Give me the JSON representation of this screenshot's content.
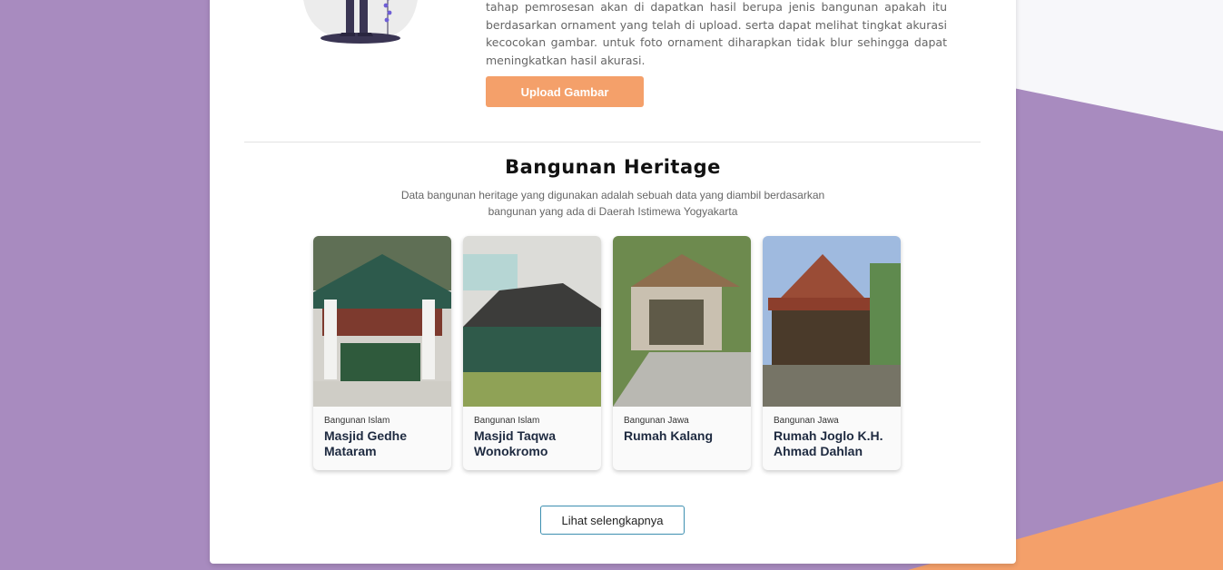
{
  "intro": {
    "text": "tahap pemrosesan akan di dapatkan hasil berupa jenis bangunan apakah itu berdasarkan ornament yang telah di upload. serta dapat melihat tingkat akurasi kecocokan gambar. untuk foto ornament diharapkan tidak blur sehingga dapat meningkatkan hasil akurasi.",
    "upload_label": "Upload Gambar"
  },
  "section": {
    "title": "Bangunan Heritage",
    "description_line1": "Data bangunan heritage yang digunakan adalah sebuah data yang diambil berdasarkan",
    "description_line2": "bangunan yang ada di Daerah Istimewa Yogyakarta"
  },
  "cards": [
    {
      "category": "Bangunan Islam",
      "name": "Masjid Gedhe Mataram"
    },
    {
      "category": "Bangunan Islam",
      "name": "Masjid Taqwa Wonokromo"
    },
    {
      "category": "Bangunan Jawa",
      "name": "Rumah Kalang"
    },
    {
      "category": "Bangunan Jawa",
      "name": "Rumah Joglo K.H. Ahmad Dahlan"
    }
  ],
  "more_label": "Lihat selengkapnya",
  "colors": {
    "background": "#a88bbf",
    "accent": "#f4a06a",
    "outline_button": "#3d8fb0"
  }
}
